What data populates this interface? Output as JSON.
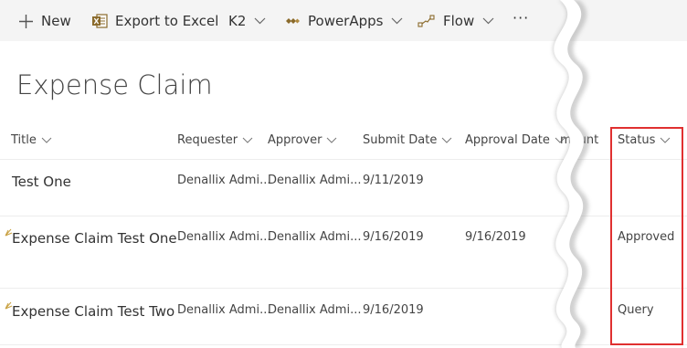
{
  "toolbar": {
    "new_label": "New",
    "export_label": "Export to Excel",
    "k2_label": "K2",
    "powerapps_label": "PowerApps",
    "flow_label": "Flow",
    "more_label": "···"
  },
  "list": {
    "title": "Expense Claim",
    "columns": {
      "title": "Title",
      "requester": "Requester",
      "approver": "Approver",
      "submit_date": "Submit Date",
      "approval_date": "Approval Date",
      "amount_partial": "mount",
      "status": "Status"
    },
    "rows": [
      {
        "title": "Test One",
        "requester": "Denallix Admi...",
        "approver": "Denallix Admi...",
        "submit_date": "9/11/2019",
        "approval_date": "",
        "status": ""
      },
      {
        "title": "Expense Claim Test One",
        "requester": "Denallix Admi...",
        "approver": "Denallix Admi...",
        "submit_date": "9/16/2019",
        "approval_date": "9/16/2019",
        "status": "Approved"
      },
      {
        "title": "Expense Claim Test Two",
        "requester": "Denallix Admi...",
        "approver": "Denallix Admi...",
        "submit_date": "9/16/2019",
        "approval_date": "",
        "status": "Query"
      }
    ]
  },
  "colors": {
    "command_bar": "#f4f4f4",
    "excel_icon": "#8a6a2b",
    "new_item_mark": "#c8a040",
    "highlight_box": "#e03030"
  },
  "icons": {
    "new": "plus-icon",
    "export": "excel-icon",
    "powerapps": "powerapps-icon",
    "flow": "flow-icon",
    "dropdown": "chevron-down-icon"
  }
}
